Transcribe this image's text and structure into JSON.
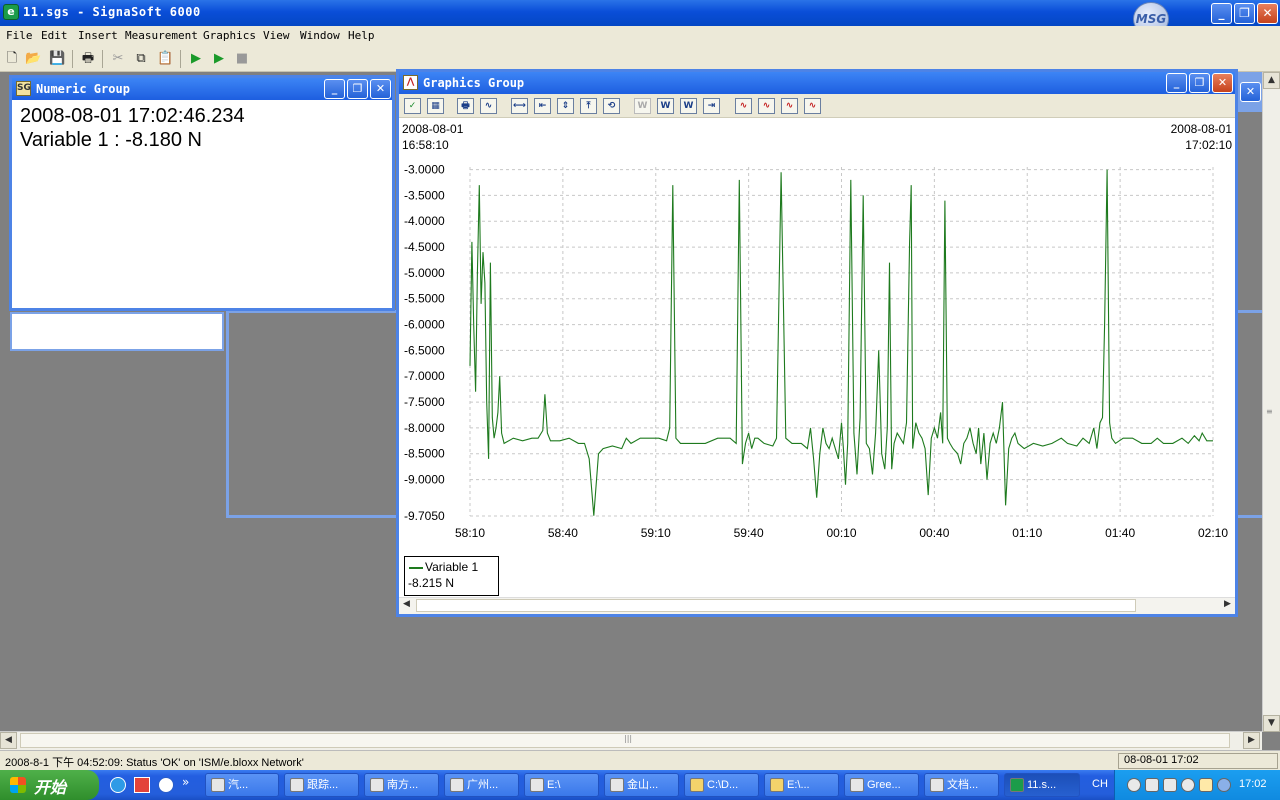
{
  "app": {
    "title": "11.sgs - SignaSoft 6000",
    "logo_text": "MSG"
  },
  "menu": [
    "File",
    "Edit",
    "Insert",
    "Measurement",
    "Graphics",
    "View",
    "Window",
    "Help"
  ],
  "numeric_group": {
    "title": "Numeric Group",
    "timestamp": "2008-08-01 17:02:46.234",
    "reading": "Variable 1 :  -8.180 N"
  },
  "graphics_group": {
    "title": "Graphics Group",
    "start_date": "2008-08-01",
    "start_time": "16:58:10",
    "end_date": "2008-08-01",
    "end_time": "17:02:10",
    "legend_name": "Variable 1",
    "legend_value": "-8.215 N"
  },
  "chart_data": {
    "type": "line",
    "title": "",
    "xlabel": "",
    "ylabel": "",
    "x_ticks": [
      "58:10",
      "58:40",
      "59:10",
      "59:40",
      "00:10",
      "00:40",
      "01:10",
      "01:40",
      "02:10"
    ],
    "y_ticks": [
      "-3.0000",
      "-3.5000",
      "-4.0000",
      "-4.5000",
      "-5.0000",
      "-5.5000",
      "-6.0000",
      "-6.5000",
      "-7.0000",
      "-7.5000",
      "-8.0000",
      "-8.5000",
      "-9.0000",
      "-9.7050"
    ],
    "ylim": [
      -9.705,
      -2.95
    ],
    "xlim_seconds": [
      0,
      240
    ],
    "grid": true,
    "series": [
      {
        "name": "Variable 1",
        "color": "#1e7a1e",
        "points": [
          [
            0,
            -6.8
          ],
          [
            0.6,
            -4.4
          ],
          [
            1.2,
            -6.0
          ],
          [
            1.8,
            -7.3
          ],
          [
            2.4,
            -5.0
          ],
          [
            3.0,
            -3.3
          ],
          [
            3.6,
            -5.6
          ],
          [
            4.2,
            -4.6
          ],
          [
            4.8,
            -5.2
          ],
          [
            5.4,
            -7.5
          ],
          [
            6.0,
            -8.6
          ],
          [
            6.6,
            -4.8
          ],
          [
            7.2,
            -7.8
          ],
          [
            7.8,
            -8.2
          ],
          [
            8.4,
            -8.0
          ],
          [
            9.0,
            -7.7
          ],
          [
            9.6,
            -7.0
          ],
          [
            10.2,
            -8.1
          ],
          [
            11,
            -8.3
          ],
          [
            14,
            -8.2
          ],
          [
            17,
            -8.25
          ],
          [
            20,
            -8.2
          ],
          [
            22,
            -8.2
          ],
          [
            23.5,
            -8.05
          ],
          [
            24.2,
            -7.35
          ],
          [
            25,
            -8.1
          ],
          [
            26,
            -8.25
          ],
          [
            29,
            -8.25
          ],
          [
            32,
            -8.2
          ],
          [
            35,
            -8.3
          ],
          [
            37,
            -8.3
          ],
          [
            38.5,
            -8.6
          ],
          [
            40,
            -9.7
          ],
          [
            41.5,
            -8.5
          ],
          [
            43,
            -8.4
          ],
          [
            46,
            -8.35
          ],
          [
            49,
            -8.4
          ],
          [
            50.5,
            -8.2
          ],
          [
            52,
            -8.3
          ],
          [
            55,
            -8.2
          ],
          [
            58,
            -8.2
          ],
          [
            61,
            -8.2
          ],
          [
            63.5,
            -8.25
          ],
          [
            64.5,
            -8.0
          ],
          [
            65.5,
            -3.3
          ],
          [
            66.5,
            -8.2
          ],
          [
            68,
            -8.3
          ],
          [
            72,
            -8.3
          ],
          [
            76,
            -8.3
          ],
          [
            80,
            -8.2
          ],
          [
            84,
            -8.2
          ],
          [
            86,
            -8.3
          ],
          [
            87,
            -3.2
          ],
          [
            88,
            -8.7
          ],
          [
            89,
            -8.3
          ],
          [
            90,
            -8.1
          ],
          [
            91,
            -8.4
          ],
          [
            92,
            -8.2
          ],
          [
            93,
            -8.2
          ],
          [
            95,
            -8.3
          ],
          [
            97.8,
            -8.35
          ],
          [
            99,
            -8.2
          ],
          [
            100.5,
            -3.05
          ],
          [
            102,
            -8.2
          ],
          [
            104,
            -8.3
          ],
          [
            107,
            -8.3
          ],
          [
            109,
            -8.4
          ],
          [
            110,
            -8.0
          ],
          [
            111,
            -8.6
          ],
          [
            112,
            -9.35
          ],
          [
            113,
            -8.5
          ],
          [
            114,
            -8.0
          ],
          [
            115,
            -8.3
          ],
          [
            116,
            -8.4
          ],
          [
            117,
            -8.2
          ],
          [
            118,
            -8.4
          ],
          [
            119,
            -8.6
          ],
          [
            120,
            -7.9
          ],
          [
            120.6,
            -8.4
          ],
          [
            121.3,
            -9.1
          ],
          [
            122,
            -8.3
          ],
          [
            123,
            -3.2
          ],
          [
            124,
            -8.1
          ],
          [
            125,
            -8.9
          ],
          [
            126,
            -7.8
          ],
          [
            127,
            -3.5
          ],
          [
            128,
            -8.3
          ],
          [
            129,
            -8.4
          ],
          [
            130,
            -8.9
          ],
          [
            131,
            -8.1
          ],
          [
            132,
            -6.5
          ],
          [
            133,
            -8.5
          ],
          [
            134,
            -8.8
          ],
          [
            134.8,
            -8.0
          ],
          [
            135.5,
            -4.8
          ],
          [
            136.2,
            -8.8
          ],
          [
            137,
            -8.3
          ],
          [
            138,
            -8.1
          ],
          [
            139,
            -8.2
          ],
          [
            140,
            -8.3
          ],
          [
            141,
            -7.9
          ],
          [
            142,
            -4.4
          ],
          [
            142.5,
            -3.3
          ],
          [
            143,
            -8.4
          ],
          [
            144,
            -7.9
          ],
          [
            145,
            -8.1
          ],
          [
            146,
            -8.2
          ],
          [
            147,
            -8.4
          ],
          [
            148,
            -9.3
          ],
          [
            149,
            -8.2
          ],
          [
            150,
            -8.0
          ],
          [
            151,
            -8.2
          ],
          [
            152,
            -7.7
          ],
          [
            152.7,
            -8.3
          ],
          [
            153.4,
            -3.6
          ],
          [
            154.2,
            -8.2
          ],
          [
            155,
            -8.3
          ],
          [
            156,
            -8.4
          ],
          [
            157.5,
            -8.5
          ],
          [
            158.5,
            -8.7
          ],
          [
            159.5,
            -8.3
          ],
          [
            160.5,
            -8.2
          ],
          [
            161.5,
            -8.0
          ],
          [
            162.5,
            -8.3
          ],
          [
            163.5,
            -8.5
          ],
          [
            164.3,
            -8.0
          ],
          [
            165,
            -8.7
          ],
          [
            166,
            -8.1
          ],
          [
            167,
            -9.0
          ],
          [
            168,
            -8.3
          ],
          [
            169,
            -8.1
          ],
          [
            170,
            -8.3
          ],
          [
            171,
            -8.0
          ],
          [
            172,
            -7.5
          ],
          [
            173,
            -9.5
          ],
          [
            174,
            -8.4
          ],
          [
            175,
            -8.2
          ],
          [
            176,
            -8.1
          ],
          [
            177,
            -8.3
          ],
          [
            179,
            -8.4
          ],
          [
            182,
            -8.3
          ],
          [
            185,
            -8.35
          ],
          [
            188,
            -8.3
          ],
          [
            191,
            -8.2
          ],
          [
            193,
            -8.3
          ],
          [
            196,
            -8.35
          ],
          [
            198,
            -8.2
          ],
          [
            200,
            -8.3
          ],
          [
            201.5,
            -8.0
          ],
          [
            202.5,
            -8.4
          ],
          [
            203.5,
            -7.9
          ],
          [
            204.3,
            -7.8
          ],
          [
            205,
            -6.0
          ],
          [
            205.8,
            -3.0
          ],
          [
            206.6,
            -7.9
          ],
          [
            207.3,
            -8.2
          ],
          [
            208.5,
            -8.3
          ],
          [
            211,
            -8.2
          ],
          [
            214,
            -8.2
          ],
          [
            217,
            -8.3
          ],
          [
            220,
            -8.3
          ],
          [
            222,
            -8.2
          ],
          [
            224,
            -8.3
          ],
          [
            227,
            -8.3
          ],
          [
            230,
            -8.2
          ],
          [
            232,
            -8.3
          ],
          [
            234,
            -8.15
          ],
          [
            235.5,
            -8.25
          ],
          [
            236.5,
            -8.1
          ],
          [
            238,
            -8.25
          ],
          [
            240,
            -8.25
          ]
        ]
      }
    ]
  },
  "status": {
    "message": "2008-8-1 下午 04:52:09: Status 'OK' on 'ISM/e.bloxx Network'",
    "clock": "08-08-01 17:02"
  },
  "taskbar": {
    "start": "开始",
    "tasks": [
      "汽...",
      "跟踪...",
      "南方...",
      "广州...",
      "E:\\",
      "金山...",
      "C:\\D...",
      "E:\\...",
      "Gree...",
      "文档...",
      "11.s..."
    ],
    "lang": "CH",
    "time": "17:02"
  }
}
